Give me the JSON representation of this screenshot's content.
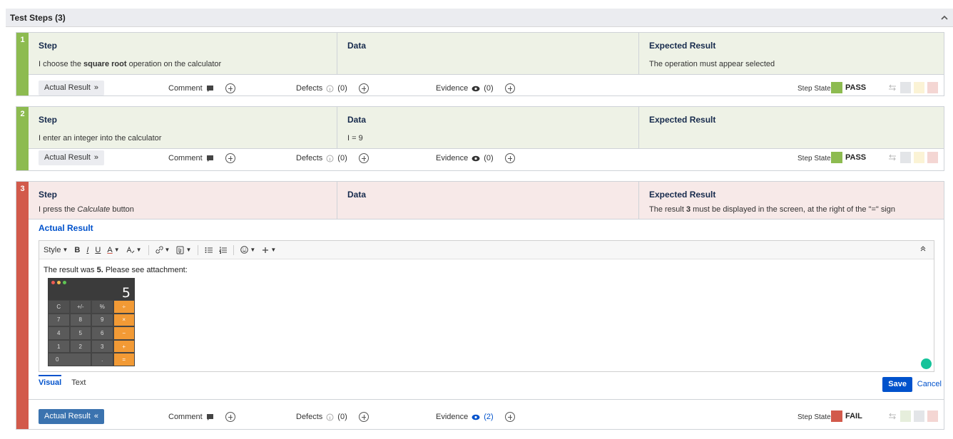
{
  "panel": {
    "title": "Test Steps (3)"
  },
  "labels": {
    "step": "Step",
    "data": "Data",
    "expected": "Expected Result",
    "actual_result": "Actual Result",
    "comment": "Comment",
    "defects": "Defects",
    "evidence": "Evidence",
    "step_state": "Step State"
  },
  "steps": [
    {
      "number": "1",
      "step_pre": "I choose the ",
      "step_em": "square root",
      "step_post": " operation on the calculator",
      "data": "",
      "expected": "The operation must appear selected",
      "defects_count": "(0)",
      "evidence_count": "(0)",
      "state": "PASS",
      "color": "#8dbb50"
    },
    {
      "number": "2",
      "step_text": "I enter an integer into the calculator",
      "data": "I = 9",
      "expected": "",
      "defects_count": "(0)",
      "evidence_count": "(0)",
      "state": "PASS",
      "color": "#8dbb50"
    },
    {
      "number": "3",
      "step_pre": "I press the ",
      "step_em": "Calculate",
      "step_post": " button",
      "data": "",
      "exp_pre": "The result ",
      "exp_em": "3",
      "exp_post": " must be displayed in the screen, at the right of the \"=\" sign",
      "defects_count": "(0)",
      "evidence_count": "(2)",
      "state": "FAIL",
      "color": "#d25a4b"
    }
  ],
  "editor": {
    "toolbar": {
      "style": "Style",
      "bold": "B",
      "italic": "I",
      "underline": "U",
      "color": "A"
    },
    "text_pre": "The result was ",
    "text_em": "5.",
    "text_post": " Please see attachment:",
    "tabs": [
      "Visual",
      "Text"
    ],
    "save": "Save",
    "cancel": "Cancel"
  },
  "calculator": {
    "display": "5",
    "keys": [
      "C",
      "+/-",
      "%",
      "÷",
      "7",
      "8",
      "9",
      "×",
      "4",
      "5",
      "6",
      "−",
      "1",
      "2",
      "3",
      "+",
      "0",
      ".",
      "="
    ]
  },
  "colors": {
    "pass": "#8dbb50",
    "fail": "#d25a4b",
    "pass_bg": "#eef2e6",
    "fail_bg": "#f7e9e8",
    "link": "#0052cc"
  }
}
